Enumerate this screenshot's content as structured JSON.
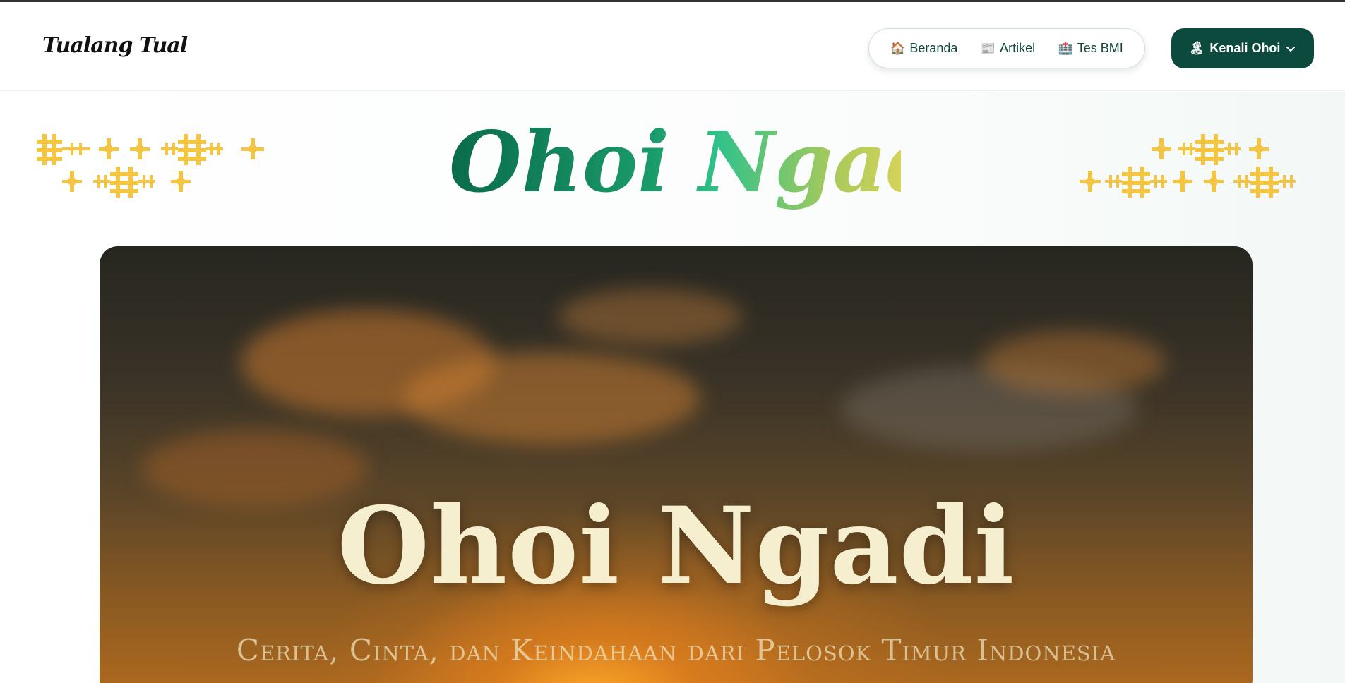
{
  "header": {
    "logo_text": "Tualang Tual",
    "nav": [
      {
        "icon": "🏠",
        "icon_name": "house-icon",
        "label": "Beranda"
      },
      {
        "icon": "📰",
        "icon_name": "newspaper-icon",
        "label": "Artikel"
      },
      {
        "icon": "🏥",
        "icon_name": "hospital-icon",
        "label": "Tes BMI"
      }
    ],
    "cta": {
      "icon": "🏝",
      "icon_name": "island-icon",
      "label": "Kenali Ohoi"
    }
  },
  "banner": {
    "title": "Ohoi Ngadi"
  },
  "hero": {
    "title": "Ohoi Ngadi",
    "subtitle": "Cerita, Cinta, dan Keindahaan dari Pelosok Timur Indonesia"
  },
  "colors": {
    "brand_dark_green": "#0b4a3d",
    "ornament_gold": "#f4c542",
    "title_gradient_start": "#0a6b4b",
    "title_gradient_end": "#d4d35a"
  }
}
